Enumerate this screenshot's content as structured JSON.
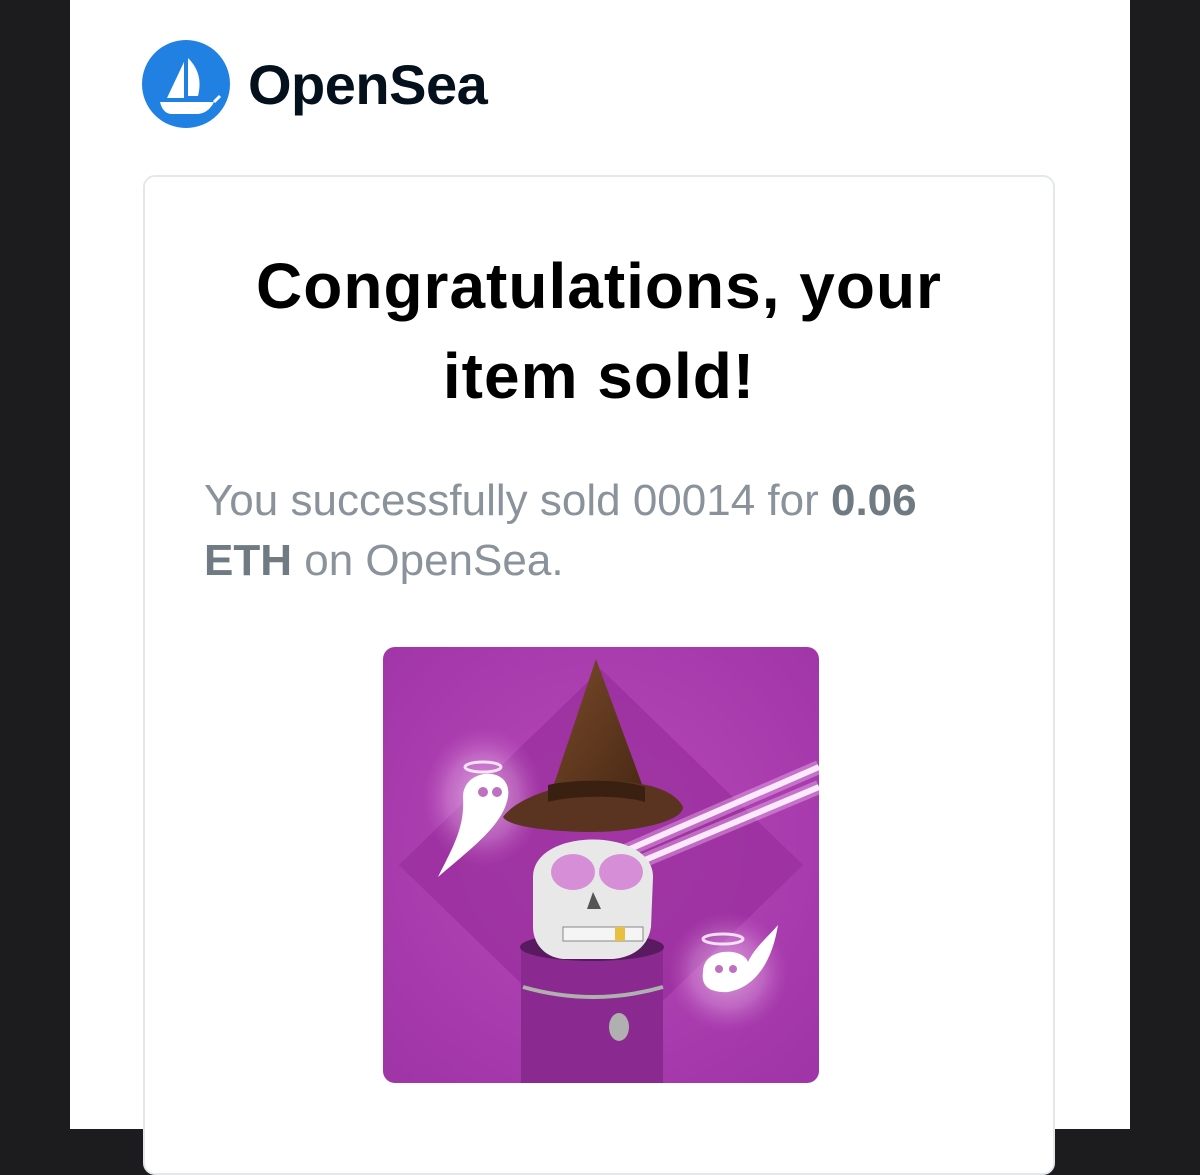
{
  "brand": {
    "name": "OpenSea",
    "logo_icon": "opensea-ship-icon",
    "logo_color": "#2081e2"
  },
  "card": {
    "title": "Congratulations, your item sold!",
    "message_prefix": "You successfully sold 00014 for ",
    "message_amount": "0.06 ETH",
    "message_suffix": " on OpenSea.",
    "image_icon": "skeleton-wizard-nft-icon"
  },
  "colors": {
    "page_background": "#1c1c1e",
    "email_background": "#ffffff",
    "title": "#000000",
    "message": "#8a939b",
    "nft_background": "#b040b0"
  }
}
